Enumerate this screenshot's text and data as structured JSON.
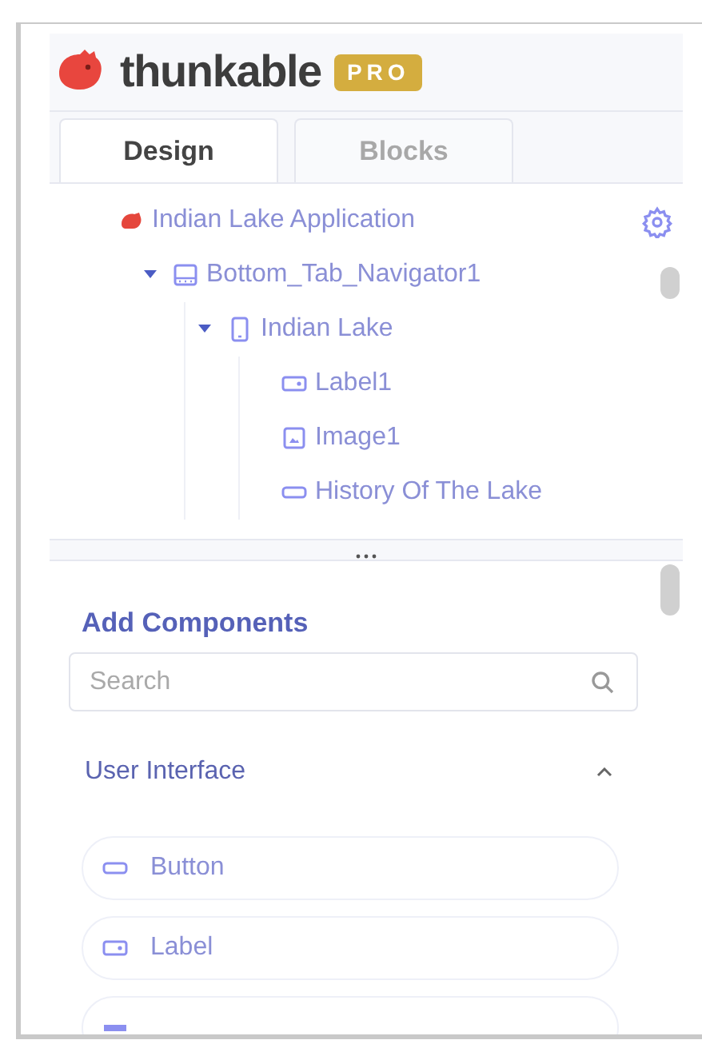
{
  "header": {
    "brand": "thunkable",
    "badge": "PRO"
  },
  "tabs": [
    {
      "label": "Design",
      "selected": true
    },
    {
      "label": "Blocks",
      "selected": false
    }
  ],
  "tree": {
    "label": "Indian Lake Application",
    "kind": "app",
    "children": [
      {
        "label": "Bottom_Tab_Navigator1",
        "kind": "navigator",
        "expanded": true,
        "children": [
          {
            "label": "Indian Lake",
            "kind": "screen",
            "expanded": true,
            "children": [
              {
                "label": "Label1",
                "kind": "label"
              },
              {
                "label": "Image1",
                "kind": "image"
              },
              {
                "label": "History Of The Lake",
                "kind": "button"
              }
            ]
          }
        ]
      }
    ]
  },
  "add_components": {
    "title": "Add Components",
    "search": {
      "placeholder": "Search"
    },
    "section": {
      "title": "User Interface",
      "expanded": true
    },
    "items": [
      {
        "label": "Button",
        "kind": "button"
      },
      {
        "label": "Label",
        "kind": "label"
      },
      {
        "kind": "input"
      }
    ]
  }
}
